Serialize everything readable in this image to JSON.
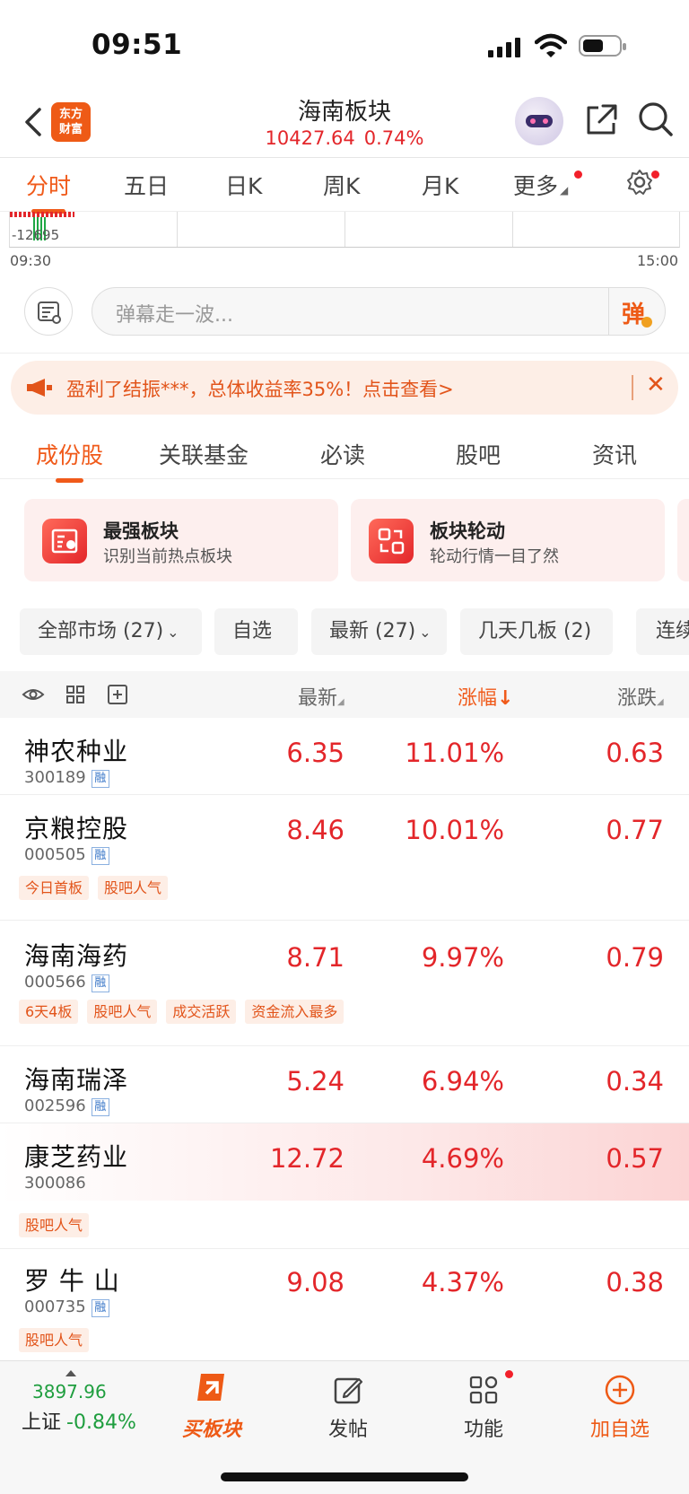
{
  "status_bar": {
    "time": "09:51"
  },
  "header": {
    "logo": "东方\n财富",
    "title": "海南板块",
    "price": "10427.64",
    "change_pct": "0.74%"
  },
  "kline_tabs": [
    "分时",
    "五日",
    "日K",
    "周K",
    "月K",
    "更多"
  ],
  "chart": {
    "volume_label": "-12695",
    "start_time": "09:30",
    "end_time": "15:00"
  },
  "danmaku": {
    "placeholder": "弹幕走一波...",
    "send_label": "弹"
  },
  "promo": {
    "text": "盈利了结振***，总体收益率35%！点击查看>"
  },
  "content_tabs": [
    "成份股",
    "关联基金",
    "必读",
    "股吧",
    "资讯"
  ],
  "cards": [
    {
      "title": "最强板块",
      "subtitle": "识别当前热点板块"
    },
    {
      "title": "板块轮动",
      "subtitle": "轮动行情一目了然"
    }
  ],
  "filters": [
    "全部市场 (27)",
    "自选",
    "最新 (27)",
    "几天几板 (2)",
    "连续"
  ],
  "table": {
    "headers": {
      "latest": "最新",
      "pct": "涨幅",
      "change": "涨跌"
    },
    "rong_badge": "融",
    "rows": [
      {
        "name": "神农种业",
        "code": "300189",
        "price": "6.35",
        "pct": "11.01%",
        "change": "0.63",
        "tags": []
      },
      {
        "name": "京粮控股",
        "code": "000505",
        "price": "8.46",
        "pct": "10.01%",
        "change": "0.77",
        "tags": [
          "今日首板",
          "股吧人气"
        ]
      },
      {
        "name": "海南海药",
        "code": "000566",
        "price": "8.71",
        "pct": "9.97%",
        "change": "0.79",
        "tags": [
          "6天4板",
          "股吧人气",
          "成交活跃",
          "资金流入最多"
        ]
      },
      {
        "name": "海南瑞泽",
        "code": "002596",
        "price": "5.24",
        "pct": "6.94%",
        "change": "0.34",
        "tags": []
      },
      {
        "name": "康芝药业",
        "code": "300086",
        "price": "12.72",
        "pct": "4.69%",
        "change": "0.57",
        "tags": [
          "股吧人气"
        ]
      },
      {
        "name": "罗 牛 山",
        "code": "000735",
        "price": "9.08",
        "pct": "4.37%",
        "change": "0.38",
        "tags": [
          "股吧人气"
        ]
      }
    ]
  },
  "bottom_bar": {
    "index_value": "3897.96",
    "index_name": "上证",
    "index_change": "-0.84%",
    "items": [
      "买板块",
      "发帖",
      "功能",
      "加自选"
    ]
  },
  "colors": {
    "accent": "#f05a1a",
    "up_red": "#e3262a",
    "down_green": "#1f9e3f"
  }
}
